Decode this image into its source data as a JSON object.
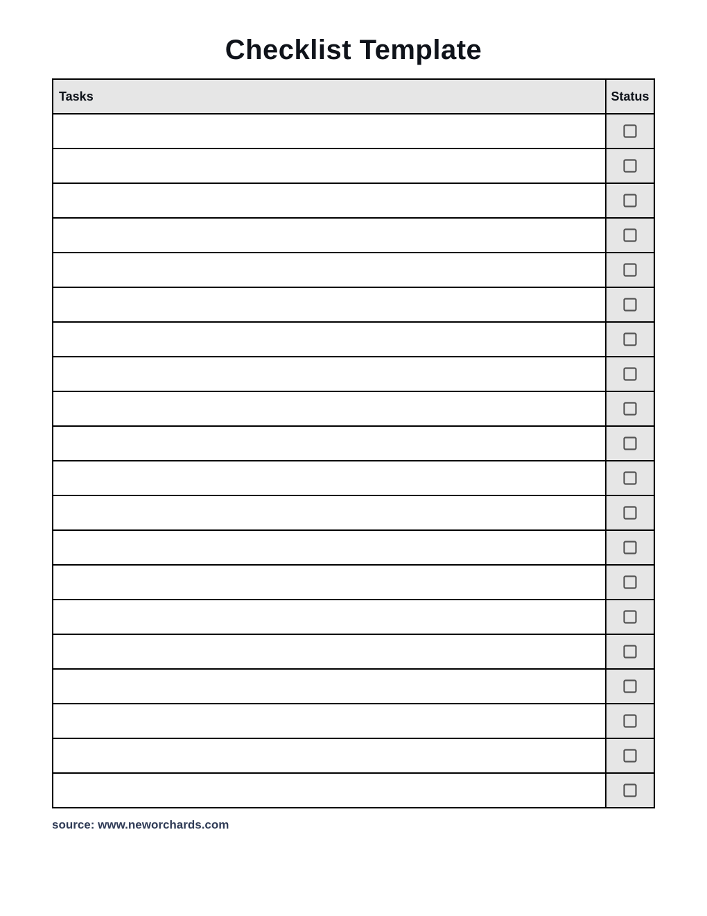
{
  "title": "Checklist Template",
  "table": {
    "headers": {
      "tasks": "Tasks",
      "status": "Status"
    },
    "rows": [
      {
        "task": "",
        "checked": false
      },
      {
        "task": "",
        "checked": false
      },
      {
        "task": "",
        "checked": false
      },
      {
        "task": "",
        "checked": false
      },
      {
        "task": "",
        "checked": false
      },
      {
        "task": "",
        "checked": false
      },
      {
        "task": "",
        "checked": false
      },
      {
        "task": "",
        "checked": false
      },
      {
        "task": "",
        "checked": false
      },
      {
        "task": "",
        "checked": false
      },
      {
        "task": "",
        "checked": false
      },
      {
        "task": "",
        "checked": false
      },
      {
        "task": "",
        "checked": false
      },
      {
        "task": "",
        "checked": false
      },
      {
        "task": "",
        "checked": false
      },
      {
        "task": "",
        "checked": false
      },
      {
        "task": "",
        "checked": false
      },
      {
        "task": "",
        "checked": false
      },
      {
        "task": "",
        "checked": false
      },
      {
        "task": "",
        "checked": false
      }
    ]
  },
  "source": "source: www.neworchards.com"
}
